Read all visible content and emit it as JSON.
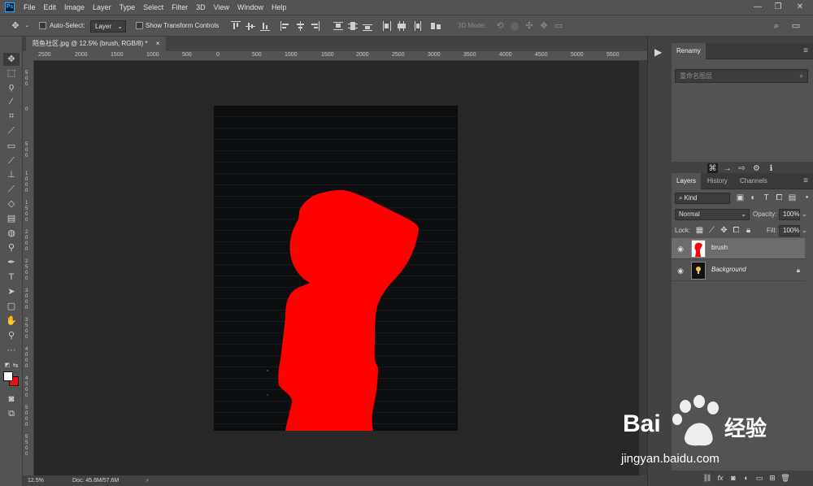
{
  "menu": [
    "File",
    "Edit",
    "Image",
    "Layer",
    "Type",
    "Select",
    "Filter",
    "3D",
    "View",
    "Window",
    "Help"
  ],
  "app_logo": "Ps",
  "window_controls": {
    "minimize": "—",
    "restore": "❐",
    "close": "✕"
  },
  "options": {
    "auto_select_label": "Auto-Select:",
    "auto_select_value": "Layer",
    "show_transform_label": "Show Transform Controls",
    "mode_3d_label": "3D Mode:"
  },
  "document_tab": {
    "title": "陌鱼社区.jpg @ 12.5% (brush, RGB/8) *",
    "close": "×"
  },
  "ruler_top": [
    "2500",
    "2000",
    "1500",
    "1000",
    "500",
    "0",
    "500",
    "1000",
    "1500",
    "2000",
    "2500",
    "3000",
    "3500",
    "4000",
    "4500",
    "5000",
    "5500"
  ],
  "ruler_left": [
    "5 0 0",
    "0",
    "5 0 0",
    "1 0 0 0",
    "1 5 0 0",
    "2 0 0 0",
    "2 5 0 0",
    "3 0 0 0",
    "3 5 0 0",
    "4 0 0 0",
    "4 5 0 0",
    "5 0 0 0",
    "5 5 0 0"
  ],
  "status": {
    "zoom": "12.5%",
    "doc": "Doc: 45.6M/57.6M",
    "arrow": "›"
  },
  "renamy_panel": {
    "title": "Renamy",
    "placeholder": "重命名图层"
  },
  "layers_panel": {
    "tabs": [
      "Layers",
      "History",
      "Channels"
    ],
    "kind_label": "Kind",
    "blend_mode": "Normal",
    "opacity_label": "Opacity:",
    "opacity_value": "100%",
    "lock_label": "Lock:",
    "fill_label": "Fill:",
    "fill_value": "100%",
    "layers": [
      {
        "name": "brush",
        "selected": true,
        "locked": false
      },
      {
        "name": "Background",
        "selected": false,
        "locked": true
      }
    ]
  },
  "watermark": {
    "brand_left": "Bai",
    "brand_right": "经验",
    "url": "jingyan.baidu.com"
  },
  "colors": {
    "foreground": "#ffffff",
    "background": "#e81010",
    "silhouette": "#ff0000"
  }
}
